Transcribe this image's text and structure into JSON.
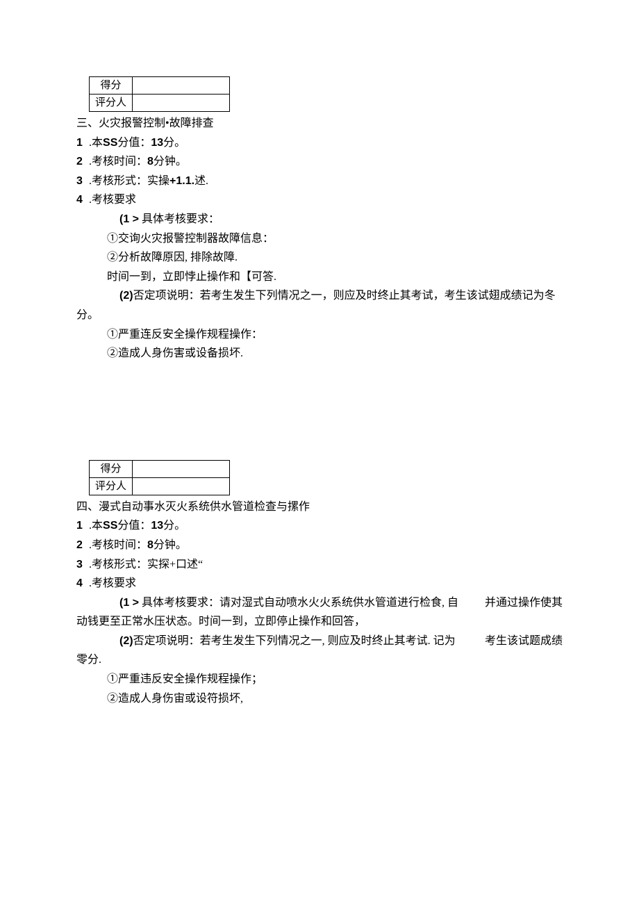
{
  "section3": {
    "score_label": "得分",
    "reviewer_label": "评分人",
    "title": "三、火灾报警控制•故障排查",
    "line1_num": "1",
    "line1_a": " .本",
    "line1_b": "SS",
    "line1_c": "分值：",
    "line1_d": "13",
    "line1_e": "分。",
    "line2_num": "2",
    "line2_a": " .考核时间：",
    "line2_b": "8",
    "line2_c": "分钟。",
    "line3_num": "3",
    "line3_a": " .考核形式：实操",
    "line3_b": "+1.1.",
    "line3_c": "述.",
    "line4_num": "4",
    "line4_a": " .考核要求",
    "req1_a": "(1 >",
    "req1_b": " 具体考核要求：",
    "sub1": "①交询火灾报警控制器故障信息：",
    "sub2": "②分析故障原因, 排除故障.",
    "sub3": "时间一到，立即悖止操作和【可答.",
    "req2_a": "(2)",
    "req2_b": "否定项说明：若考生发生下列情况之一，则应及时终止其考试，考生该试翅成绩记为冬",
    "req2_c": "分。",
    "sub4": "①严重连反安全操作规程操作：",
    "sub5": "②造成人身伤害或设备损坏."
  },
  "section4": {
    "score_label": "得分",
    "reviewer_label": "评分人",
    "title": "四、漫式自动事水灭火系统供水管道检查与摞作",
    "line1_num": "1",
    "line1_a": " .本",
    "line1_b": "SS",
    "line1_c": "分值：",
    "line1_d": "13",
    "line1_e": "分。",
    "line2_num": "2",
    "line2_a": " .考核时间：",
    "line2_b": "8",
    "line2_c": "分钟。",
    "line3_num": "3",
    "line3_a": " .考核形式：实探+口述“",
    "line4_num": "4",
    "line4_a": " .考核要求",
    "req1_a": "(1 >",
    "req1_b": " 具体考核要求：请对湿式自动喷水火火系统供水管道进行检食, 自",
    "req1_c": "并通过操作使其",
    "req1_d": "动钱更至正常水压状态。时间一到，立即停止操作和回答，",
    "req2_a": "(2)",
    "req2_b": "否定项说明：若考生发生下列情况之一, 则应及时终止其考试. 记为",
    "req2_c": "考生该试题成绩",
    "req2_d": "零分.",
    "sub1": "①严重违反安全操作规程操作；",
    "sub2": "②造成人身伤宙或设符损坏,"
  }
}
